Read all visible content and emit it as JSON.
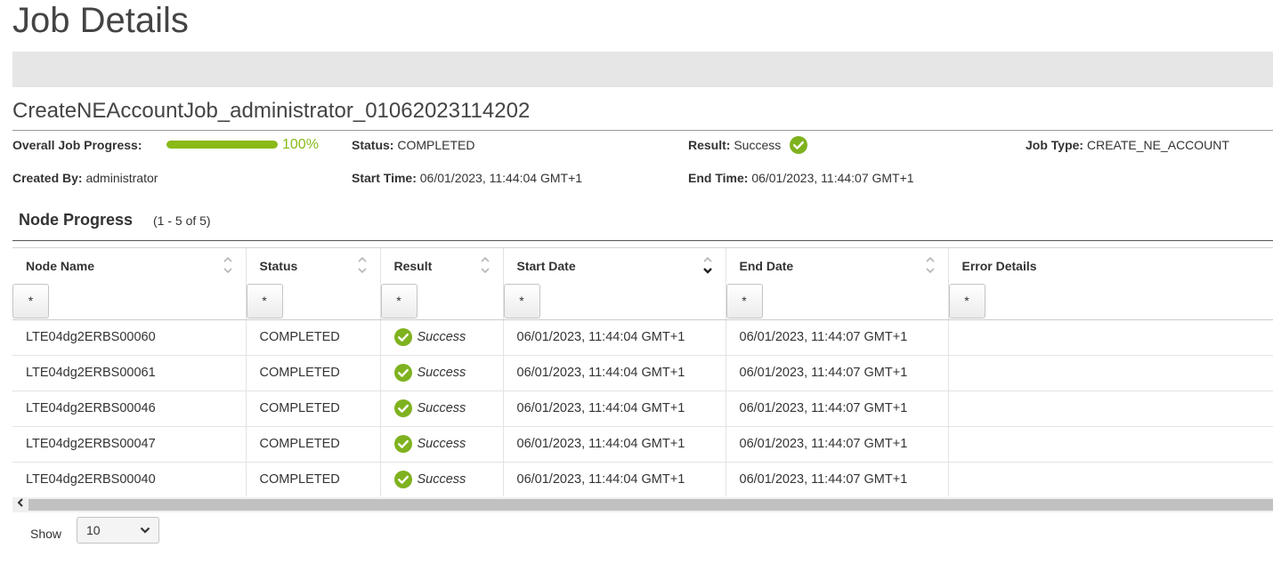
{
  "page": {
    "title": "Job Details"
  },
  "job": {
    "name": "CreateNEAccountJob_administrator_01062023114202",
    "progress_label": "Overall Job Progress:",
    "progress_value": 100,
    "progress_text": "100%",
    "status_label": "Status:",
    "status_value": "COMPLETED",
    "result_label": "Result:",
    "result_value": "Success",
    "job_type_label": "Job Type:",
    "job_type_value": "CREATE_NE_ACCOUNT",
    "created_by_label": "Created By:",
    "created_by_value": "administrator",
    "start_time_label": "Start Time:",
    "start_time_value": "06/01/2023, 11:44:04 GMT+1",
    "end_time_label": "End Time:",
    "end_time_value": "06/01/2023, 11:44:07 GMT+1"
  },
  "node_progress": {
    "title": "Node Progress",
    "count": "(1 - 5 of 5)",
    "columns": [
      {
        "label": "Node Name",
        "sortable": true,
        "sort": "none"
      },
      {
        "label": "Status",
        "sortable": true,
        "sort": "none"
      },
      {
        "label": "Result",
        "sortable": true,
        "sort": "none"
      },
      {
        "label": "Start Date",
        "sortable": true,
        "sort": "descending"
      },
      {
        "label": "End Date",
        "sortable": true,
        "sort": "none"
      },
      {
        "label": "Error Details",
        "sortable": false,
        "sort": "none"
      }
    ],
    "filter_placeholder": "*",
    "rows": [
      {
        "node": "LTE04dg2ERBS00060",
        "status": "COMPLETED",
        "result": "Success",
        "start": "06/01/2023, 11:44:04 GMT+1",
        "end": "06/01/2023, 11:44:07 GMT+1",
        "error": ""
      },
      {
        "node": "LTE04dg2ERBS00061",
        "status": "COMPLETED",
        "result": "Success",
        "start": "06/01/2023, 11:44:04 GMT+1",
        "end": "06/01/2023, 11:44:07 GMT+1",
        "error": ""
      },
      {
        "node": "LTE04dg2ERBS00046",
        "status": "COMPLETED",
        "result": "Success",
        "start": "06/01/2023, 11:44:04 GMT+1",
        "end": "06/01/2023, 11:44:07 GMT+1",
        "error": ""
      },
      {
        "node": "LTE04dg2ERBS00047",
        "status": "COMPLETED",
        "result": "Success",
        "start": "06/01/2023, 11:44:04 GMT+1",
        "end": "06/01/2023, 11:44:07 GMT+1",
        "error": ""
      },
      {
        "node": "LTE04dg2ERBS00040",
        "status": "COMPLETED",
        "result": "Success",
        "start": "06/01/2023, 11:44:04 GMT+1",
        "end": "06/01/2023, 11:44:07 GMT+1",
        "error": ""
      }
    ]
  },
  "pagination": {
    "show_label": "Show",
    "page_size": "10"
  },
  "colors": {
    "accent_green": "#89ba17",
    "success_icon": "#7fb21f"
  },
  "icons": {
    "success": "check-circle-icon",
    "sort": "sort-arrows-icon",
    "scroll_left": "chevron-left-icon",
    "select": "chevron-down-icon"
  }
}
